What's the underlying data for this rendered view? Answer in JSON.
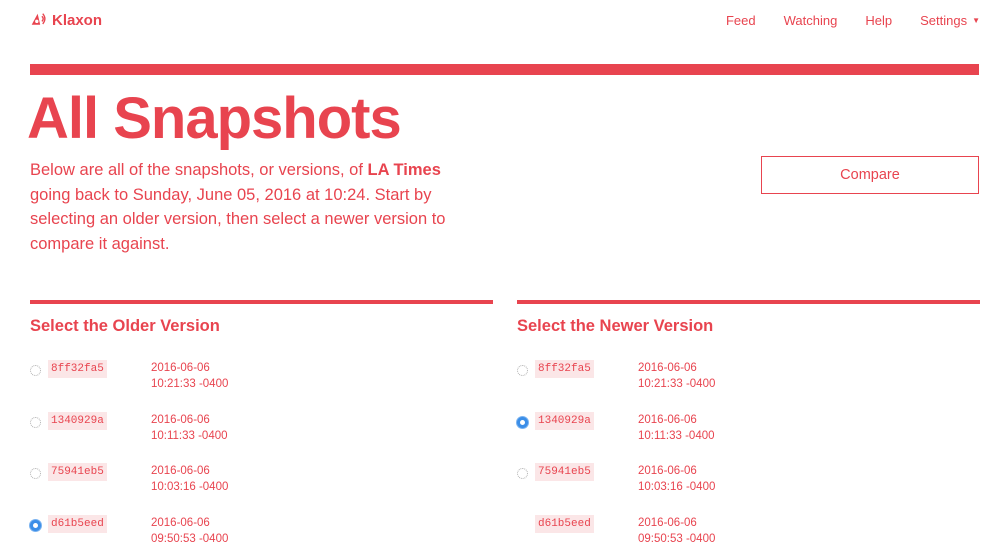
{
  "app": {
    "name": "Klaxon"
  },
  "nav": {
    "items": [
      "Feed",
      "Watching",
      "Help",
      "Settings"
    ]
  },
  "page": {
    "title": "All Snapshots",
    "intro_before": "Below are all of the snapshots, or versions, of ",
    "site_name": "LA Times",
    "intro_after": " going back to Sunday, June 05, 2016 at 10:24. Start by selecting an older version, then select a newer version to compare it against.",
    "compare_label": "Compare"
  },
  "older": {
    "title": "Select the Older Version",
    "rows": [
      {
        "hash": "8ff32fa5",
        "date": "2016-06-06",
        "time": "10:21:33 -0400",
        "checked": false,
        "show_radio": true
      },
      {
        "hash": "1340929a",
        "date": "2016-06-06",
        "time": "10:11:33 -0400",
        "checked": false,
        "show_radio": true
      },
      {
        "hash": "75941eb5",
        "date": "2016-06-06",
        "time": "10:03:16 -0400",
        "checked": false,
        "show_radio": true
      },
      {
        "hash": "d61b5eed",
        "date": "2016-06-06",
        "time": "09:50:53 -0400",
        "checked": true,
        "show_radio": true
      }
    ]
  },
  "newer": {
    "title": "Select the Newer Version",
    "rows": [
      {
        "hash": "8ff32fa5",
        "date": "2016-06-06",
        "time": "10:21:33 -0400",
        "checked": false,
        "show_radio": true
      },
      {
        "hash": "1340929a",
        "date": "2016-06-06",
        "time": "10:11:33 -0400",
        "checked": true,
        "show_radio": true
      },
      {
        "hash": "75941eb5",
        "date": "2016-06-06",
        "time": "10:03:16 -0400",
        "checked": false,
        "show_radio": true
      },
      {
        "hash": "d61b5eed",
        "date": "2016-06-06",
        "time": "09:50:53 -0400",
        "checked": false,
        "show_radio": false
      }
    ]
  },
  "colors": {
    "accent": "#e8444f",
    "hash_bg": "#fbe6e7",
    "radio_checked": "#3b8ee8"
  }
}
